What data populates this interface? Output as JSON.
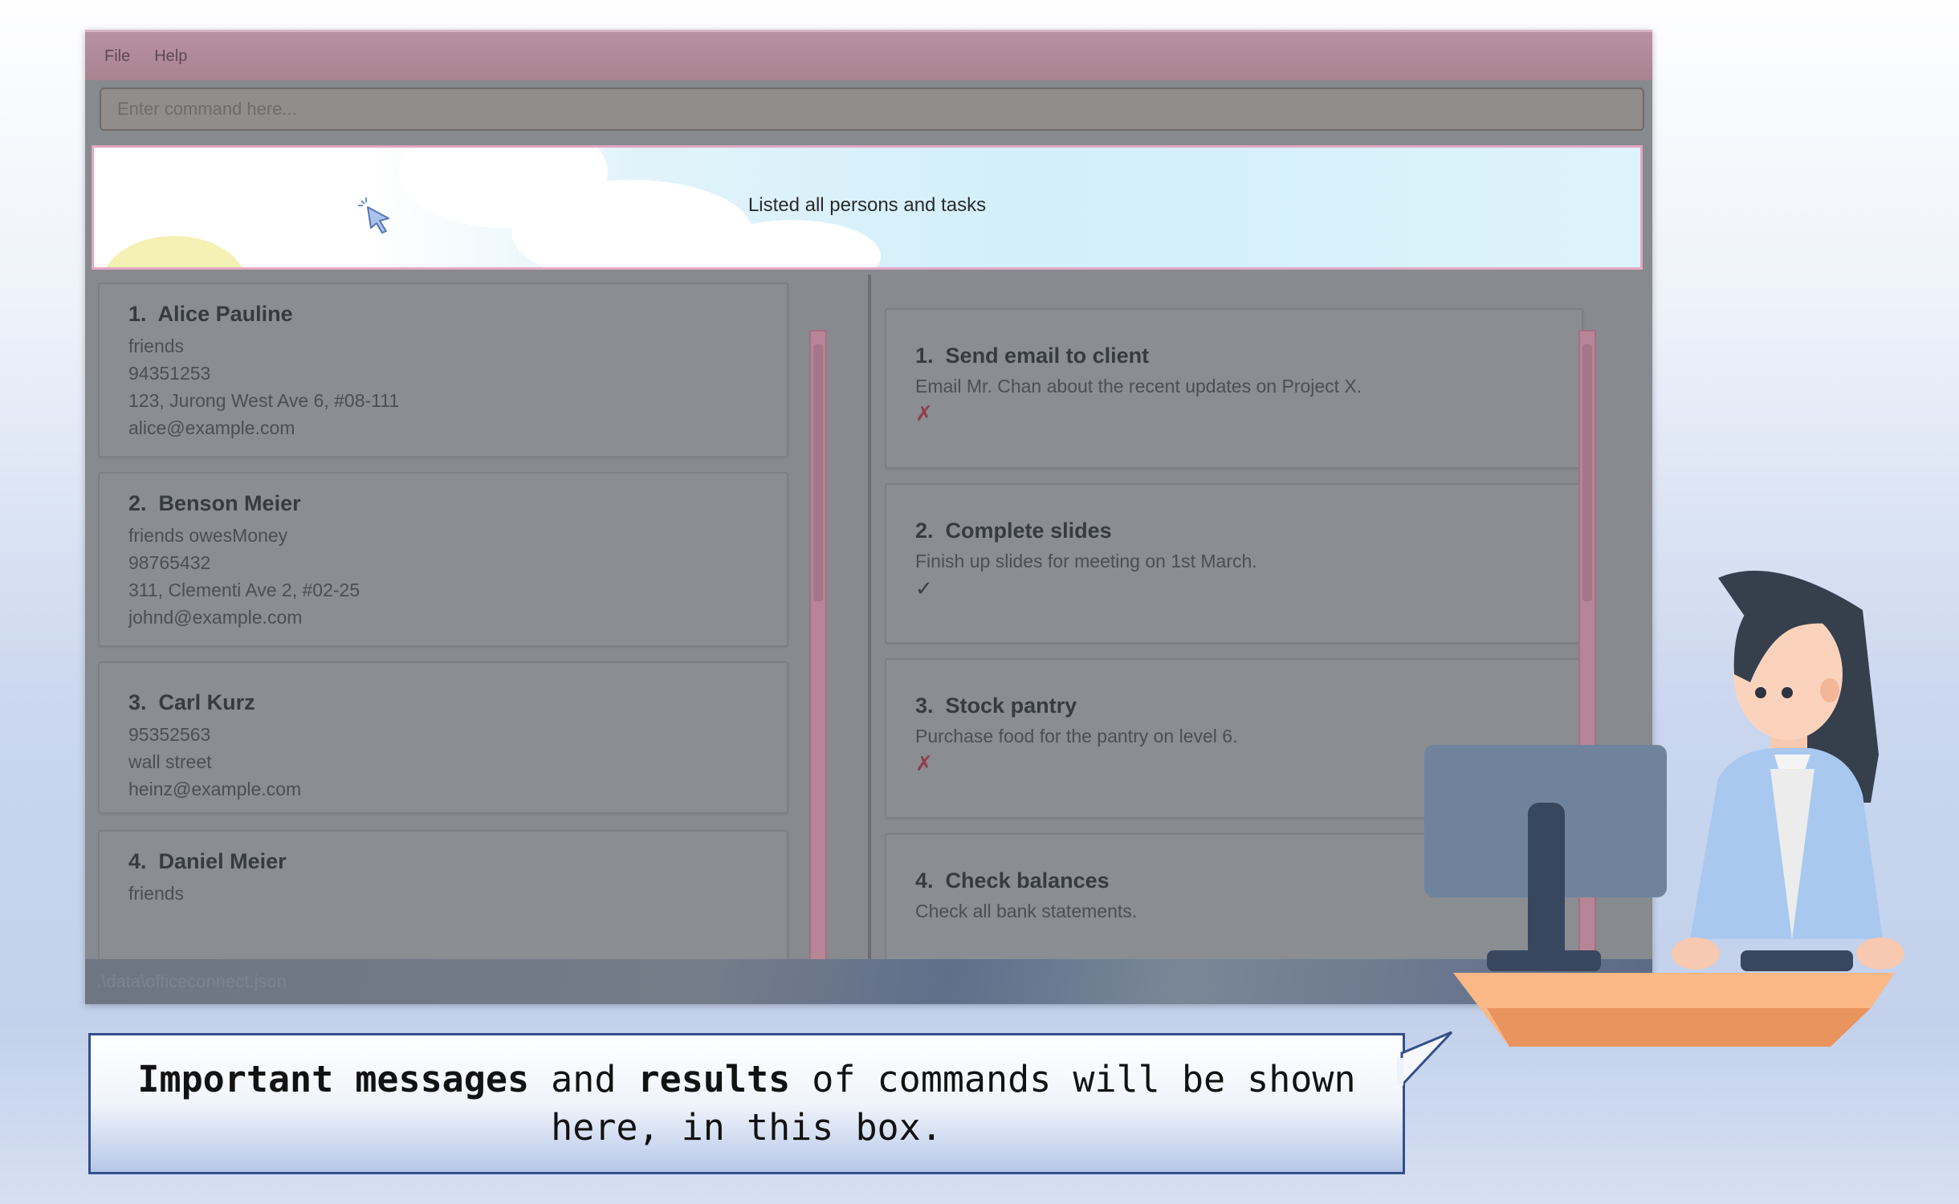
{
  "menubar": {
    "file_label": "File",
    "help_label": "Help"
  },
  "command_box": {
    "placeholder": "Enter command here..."
  },
  "result_display": {
    "message": "Listed all persons and tasks"
  },
  "persons": [
    {
      "index": "1.",
      "name": "Alice Pauline",
      "lines": [
        "friends",
        "94351253",
        "123, Jurong West Ave 6, #08-111",
        "alice@example.com"
      ]
    },
    {
      "index": "2.",
      "name": "Benson Meier",
      "lines": [
        "friends  owesMoney",
        "98765432",
        "311, Clementi Ave 2, #02-25",
        "johnd@example.com"
      ]
    },
    {
      "index": "3.",
      "name": "Carl Kurz",
      "lines": [
        "95352563",
        "wall street",
        "heinz@example.com"
      ]
    },
    {
      "index": "4.",
      "name": "Daniel Meier",
      "lines": [
        "friends"
      ]
    }
  ],
  "tasks": [
    {
      "index": "1.",
      "title": "Send email to client",
      "description": "Email Mr. Chan about the recent updates on Project X.",
      "status": "✗",
      "done": false
    },
    {
      "index": "2.",
      "title": "Complete slides",
      "description": "Finish up slides for meeting on 1st March.",
      "status": "✓",
      "done": true
    },
    {
      "index": "3.",
      "title": "Stock pantry",
      "description": "Purchase food for the pantry on level 6.",
      "status": "✗",
      "done": false
    },
    {
      "index": "4.",
      "title": "Check balances",
      "description": "Check all bank statements.",
      "status": "",
      "done": false
    }
  ],
  "statusbar": {
    "path": ".\\data\\officeconnect.json"
  },
  "caption": {
    "bold1": "Important messages",
    "text1": " and ",
    "bold2": "results",
    "text2": " of commands will be shown here, in this box."
  },
  "colors": {
    "window_overlay": "#878a8f",
    "menubar": "#b892a2",
    "caption_border": "#334f8c",
    "cross_mark": "#8f3d4e"
  },
  "icons": {
    "cursor": "pointer-cursor-icon",
    "illustration": "office-worker-at-computer"
  }
}
